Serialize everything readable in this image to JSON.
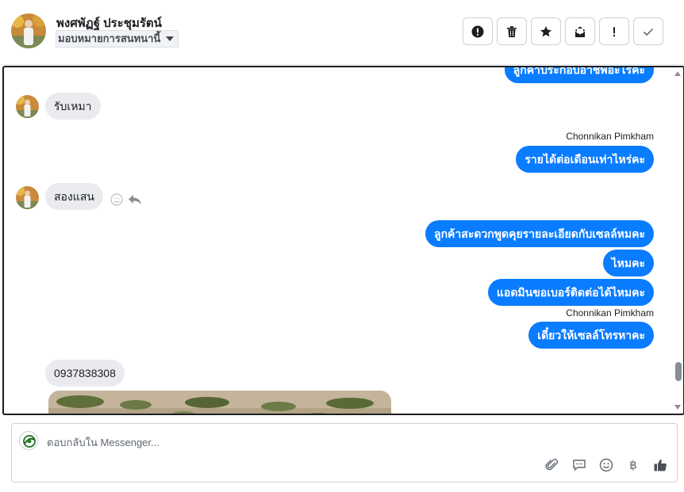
{
  "header": {
    "contact_name": "พงศพัฏฐ์ ประชุมรัตน์",
    "assign_label": "มอบหมายการสนทนานี้",
    "toolbar": [
      {
        "name": "mark-spam-button",
        "icon": "alert-circle-icon"
      },
      {
        "name": "delete-button",
        "icon": "trash-icon"
      },
      {
        "name": "star-button",
        "icon": "star-icon"
      },
      {
        "name": "mark-unread-button",
        "icon": "envelope-icon"
      },
      {
        "name": "follow-up-button",
        "icon": "exclamation-icon"
      },
      {
        "name": "mark-done-button",
        "icon": "check-icon"
      }
    ]
  },
  "messages": {
    "m1_partial": "ลูกค้าประกอบอาชีพอะไรคะ",
    "m2_in": "รับเหมา",
    "m3_sender": "Chonnikan Pimkham",
    "m3_out": "รายได้ต่อเดือนเท่าไหร่คะ",
    "m4_in": "สองแสน",
    "m5_out": "ลูกค้าสะดวกพูดคุยรายละเอียดกับเซลล์หมคะ",
    "m6_out": "ไหมคะ",
    "m7_out": "แอดมินขอเบอร์ติดต่อได้ไหมคะ",
    "m8_sender": "Chonnikan Pimkham",
    "m8_out": "เดี๋ยวให้เซลล์โทรหาคะ",
    "m9_in": "0937838308"
  },
  "composer": {
    "placeholder": "ตอบกลับใน Messenger...",
    "tools": [
      "paperclip-icon",
      "chat-bubble-icon",
      "smiley-icon",
      "baht-icon",
      "thumbs-up-icon"
    ]
  },
  "colors": {
    "outgoing": "#0a7cff",
    "incoming": "#e9ebee",
    "thumbs_up": "#4b4f56"
  }
}
